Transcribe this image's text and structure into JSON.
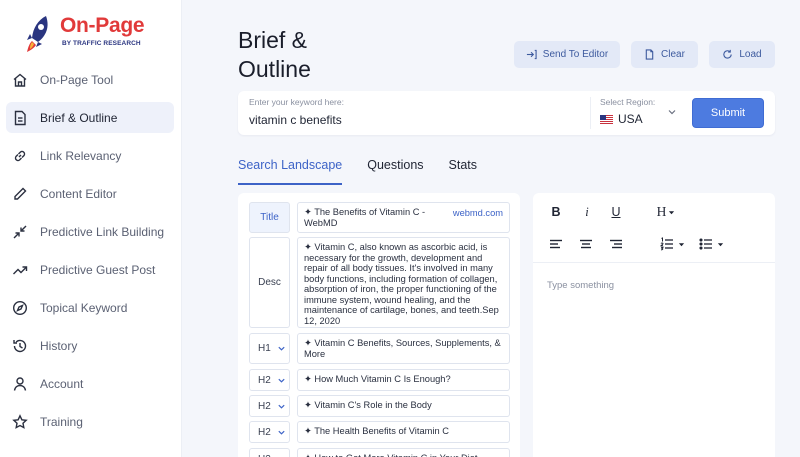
{
  "brand": {
    "name": "On-Page",
    "tagline": "BY TRAFFIC RESEARCH"
  },
  "sidebar": {
    "items": [
      {
        "label": "On-Page Tool",
        "icon": "home-icon"
      },
      {
        "label": "Brief & Outline",
        "icon": "document-icon",
        "active": true
      },
      {
        "label": "Link Relevancy",
        "icon": "link-icon"
      },
      {
        "label": "Content Editor",
        "icon": "pencil-icon"
      },
      {
        "label": "Predictive Link Building",
        "icon": "arrows-in-icon"
      },
      {
        "label": "Predictive Guest Post",
        "icon": "trending-up-icon"
      },
      {
        "label": "Topical Keyword",
        "icon": "compass-icon"
      },
      {
        "label": "History",
        "icon": "history-icon"
      },
      {
        "label": "Account",
        "icon": "user-icon"
      },
      {
        "label": "Training",
        "icon": "star-icon"
      }
    ]
  },
  "header": {
    "title": "Brief & Outline",
    "buttons": {
      "send_to_editor": "Send To Editor",
      "clear": "Clear",
      "load": "Load"
    }
  },
  "keyword": {
    "label": "Enter your keyword here:",
    "value": "vitamin c benefits",
    "region_label": "Select Region:",
    "region_value": "USA",
    "submit": "Submit"
  },
  "tabs": [
    {
      "label": "Search Landscape",
      "active": true
    },
    {
      "label": "Questions"
    },
    {
      "label": "Stats"
    }
  ],
  "outline": {
    "title": {
      "tag": "Title",
      "text": "✦ The Benefits of Vitamin C - WebMD",
      "source": "webmd.com"
    },
    "desc": {
      "tag": "Desc",
      "text": "✦ Vitamin C, also known as ascorbic acid, is necessary for the growth, development and repair of all body tissues. It's involved in many body functions, including formation of collagen, absorption of iron, the proper functioning of the immune system, wound healing, and the maintenance of cartilage, bones, and teeth.Sep 12, 2020"
    },
    "headings": [
      {
        "level": "H1",
        "text": "✦ Vitamin C Benefits, Sources, Supplements, & More"
      },
      {
        "level": "H2",
        "text": "✦ How Much Vitamin C Is Enough?"
      },
      {
        "level": "H2",
        "text": "✦ Vitamin C's Role in the Body"
      },
      {
        "level": "H2",
        "text": "✦ The Health Benefits of Vitamin C"
      },
      {
        "level": "H2",
        "text": "✦ How to Get More Vitamin C in Your Diet"
      }
    ]
  },
  "editor": {
    "bold": "B",
    "italic": "i",
    "underline": "U",
    "heading": "H",
    "placeholder": "Type something"
  },
  "colors": {
    "accent": "#3d63c7",
    "submit": "#4d7be0",
    "brand_red": "#e13a3a",
    "brand_navy": "#2a3580"
  }
}
